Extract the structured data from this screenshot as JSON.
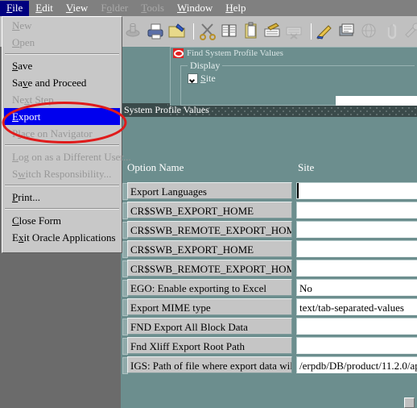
{
  "app": {
    "menubar": [
      {
        "label": "File",
        "accel": "F",
        "state": "active"
      },
      {
        "label": "Edit",
        "accel": "E",
        "state": "normal"
      },
      {
        "label": "View",
        "accel": "V",
        "state": "normal"
      },
      {
        "label": "Folder",
        "accel": "o",
        "state": "disabled"
      },
      {
        "label": "Tools",
        "accel": "T",
        "state": "disabled"
      },
      {
        "label": "Window",
        "accel": "W",
        "state": "normal"
      },
      {
        "label": "Help",
        "accel": "H",
        "state": "normal"
      }
    ],
    "toolbar": [
      {
        "name": "zoom-icon",
        "state": "disabled"
      },
      {
        "name": "print-icon",
        "state": "enabled"
      },
      {
        "name": "open-folder-icon",
        "state": "enabled"
      },
      {
        "name": "separator",
        "state": "none"
      },
      {
        "name": "cut-scissors-icon",
        "state": "enabled"
      },
      {
        "name": "copy-icon",
        "state": "enabled"
      },
      {
        "name": "paste-clipboard-icon",
        "state": "enabled"
      },
      {
        "name": "new-record-icon",
        "state": "enabled"
      },
      {
        "name": "delete-record-icon",
        "state": "disabled"
      },
      {
        "name": "separator",
        "state": "none"
      },
      {
        "name": "edit-pencil-icon",
        "state": "enabled"
      },
      {
        "name": "translations-icon",
        "state": "enabled"
      },
      {
        "name": "globe-icon",
        "state": "disabled"
      },
      {
        "name": "attachment-paperclip-icon",
        "state": "disabled"
      },
      {
        "name": "tools-icon",
        "state": "disabled"
      }
    ]
  },
  "file_menu": {
    "items": [
      {
        "label": "New",
        "accel": "N",
        "state": "disabled",
        "type": "item"
      },
      {
        "label": "Open",
        "accel": "O",
        "state": "disabled",
        "type": "item"
      },
      {
        "label": "",
        "type": "separator"
      },
      {
        "label": "Save",
        "accel": "S",
        "state": "enabled",
        "type": "item"
      },
      {
        "label": "Save and Proceed",
        "accel": "v",
        "state": "enabled",
        "type": "item"
      },
      {
        "label": "Next Step",
        "accel": "x",
        "state": "disabled",
        "type": "item"
      },
      {
        "label": "Export",
        "accel": "E",
        "state": "selected",
        "type": "item"
      },
      {
        "label": "Place on Navigator",
        "accel": "l",
        "state": "disabled",
        "type": "item"
      },
      {
        "label": "",
        "type": "separator"
      },
      {
        "label": "Log on as a Different User...",
        "accel": "L",
        "state": "disabled",
        "type": "item"
      },
      {
        "label": "Switch Responsibility...",
        "accel": "w",
        "state": "disabled",
        "type": "item"
      },
      {
        "label": "",
        "type": "separator"
      },
      {
        "label": "Print...",
        "accel": "P",
        "state": "enabled",
        "type": "item"
      },
      {
        "label": "",
        "type": "separator"
      },
      {
        "label": "Close Form",
        "accel": "C",
        "state": "enabled",
        "type": "item"
      },
      {
        "label": "Exit Oracle Applications",
        "accel": "x",
        "state": "enabled",
        "type": "item"
      }
    ]
  },
  "annotation": {
    "shape": "ellipse",
    "color": "#e01b1b",
    "targets": "Export"
  },
  "find_dialog": {
    "title": "Find System Profile Values",
    "logo_icon": "oracle-logo-icon",
    "group_label": "Display",
    "checkbox": {
      "label": "Site",
      "checked": true
    }
  },
  "profile_window": {
    "title": "System Profile Values",
    "columns": [
      "Option Name",
      "Site"
    ],
    "rows": [
      {
        "name": "Export Languages",
        "site": ""
      },
      {
        "name": "CR$SWB_EXPORT_HOME",
        "site": ""
      },
      {
        "name": "CR$SWB_REMOTE_EXPORT_HOME",
        "site": ""
      },
      {
        "name": "CR$SWB_EXPORT_HOME",
        "site": ""
      },
      {
        "name": "CR$SWB_REMOTE_EXPORT_HOME",
        "site": ""
      },
      {
        "name": "EGO: Enable exporting to Excel",
        "site": "No"
      },
      {
        "name": "Export MIME type",
        "site": "text/tab-separated-values"
      },
      {
        "name": "FND Export All Block Data",
        "site": ""
      },
      {
        "name": "Fnd Xliff Export Root Path",
        "site": ""
      },
      {
        "name": "IGS: Path of file where export data will",
        "site": "/erpdb/DB/product/11.2.0/ap"
      }
    ]
  },
  "colors": {
    "menubar_bg": "#808080",
    "menubar_active": "#00007f",
    "toolbar_bg": "#c0c0c0",
    "menu_bg": "#c8c8c8",
    "menu_select": "#0000ee",
    "window_teal": "#6c8e8e",
    "titlebar_dark": "#3a4a4a",
    "field_bg": "#ffffff",
    "namecell_bg": "#c5c5c5",
    "annotation_red": "#e01b1b",
    "desktop_gray": "#6b6b6b"
  }
}
